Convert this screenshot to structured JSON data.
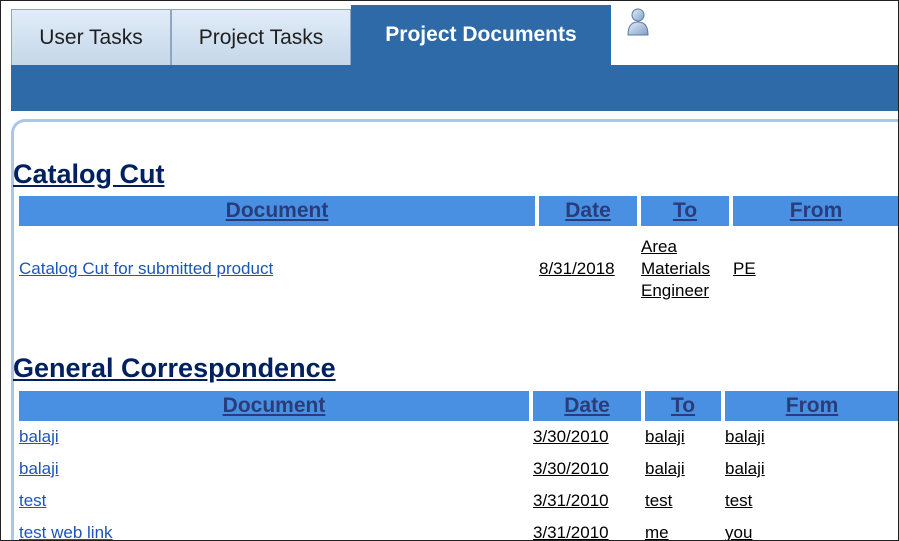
{
  "tabs": {
    "user_tasks": "User Tasks",
    "project_tasks": "Project Tasks",
    "project_documents": "Project Documents"
  },
  "sections": [
    {
      "title": "Catalog Cut",
      "headers": [
        "Document",
        "Date",
        "To",
        "From"
      ],
      "rows": [
        {
          "document": "Catalog Cut for submitted product",
          "date": "8/31/2018",
          "to": "Area Materials Engineer",
          "from": "PE"
        }
      ]
    },
    {
      "title": "General Correspondence",
      "headers": [
        "Document",
        "Date",
        "To",
        "From"
      ],
      "rows": [
        {
          "document": "balaji",
          "date": "3/30/2010",
          "to": "balaji",
          "from": "balaji"
        },
        {
          "document": "balaji",
          "date": "3/30/2010",
          "to": "balaji",
          "from": "balaji"
        },
        {
          "document": "test",
          "date": "3/31/2010",
          "to": "test",
          "from": "test"
        },
        {
          "document": "test web link",
          "date": "3/31/2010",
          "to": "me",
          "from": "you"
        }
      ]
    }
  ],
  "icons": {
    "user": "user-icon"
  },
  "colors": {
    "accent": "#2e6aa8",
    "header_bg": "#4a90e2",
    "title": "#002060",
    "link": "#1a56b8"
  }
}
